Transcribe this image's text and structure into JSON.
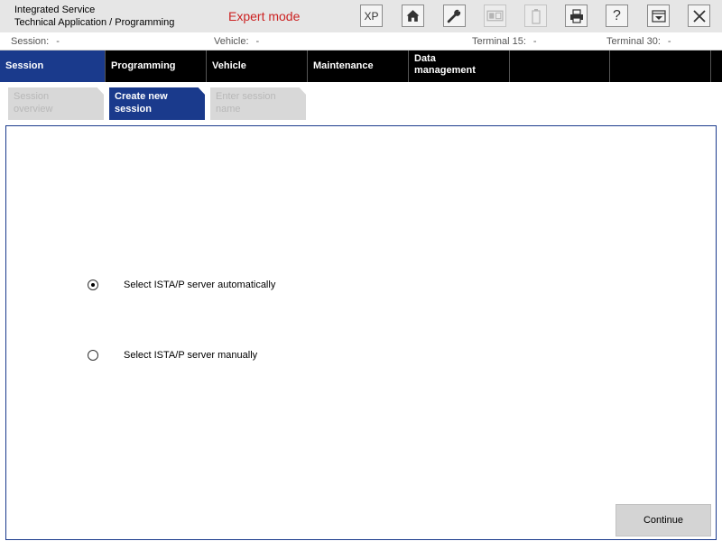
{
  "header": {
    "title_line1": "Integrated Service",
    "title_line2": "Technical Application / Programming",
    "mode": "Expert mode",
    "toolbar": [
      {
        "name": "xp-button",
        "icon": "xp-text",
        "label": "XP",
        "enabled": true
      },
      {
        "name": "home-button",
        "icon": "home-icon",
        "enabled": true
      },
      {
        "name": "service-button",
        "icon": "wrench-icon",
        "enabled": true
      },
      {
        "name": "vehicle-id-button",
        "icon": "id-card-icon",
        "enabled": false
      },
      {
        "name": "battery-button",
        "icon": "battery-icon",
        "enabled": false
      },
      {
        "name": "print-button",
        "icon": "printer-icon",
        "enabled": true
      },
      {
        "name": "help-button",
        "icon": "help-icon",
        "label": "?",
        "enabled": true
      },
      {
        "name": "minimize-button",
        "icon": "minimize-icon",
        "enabled": true
      },
      {
        "name": "close-button",
        "icon": "close-icon",
        "enabled": true
      }
    ]
  },
  "status": {
    "session_label": "Session:",
    "session_value": "-",
    "vehicle_label": "Vehicle:",
    "vehicle_value": "-",
    "terminal15_label": "Terminal 15:",
    "terminal15_value": "-",
    "terminal30_label": "Terminal 30:",
    "terminal30_value": "-"
  },
  "nav": {
    "tabs": [
      {
        "label": "Session",
        "active": true
      },
      {
        "label": "Programming",
        "active": false
      },
      {
        "label": "Vehicle",
        "active": false
      },
      {
        "label": "Maintenance",
        "active": false
      },
      {
        "label_line1": "Data",
        "label_line2": "management",
        "active": false
      }
    ]
  },
  "subtabs": [
    {
      "line1": "Session",
      "line2": "overview",
      "active": false
    },
    {
      "line1": "Create new",
      "line2": "session",
      "active": true
    },
    {
      "line1": "Enter session",
      "line2": "name",
      "active": false
    }
  ],
  "main": {
    "options": [
      {
        "label": "Select ISTA/P server automatically",
        "selected": true
      },
      {
        "label": "Select ISTA/P server manually",
        "selected": false
      }
    ],
    "continue_label": "Continue"
  },
  "colors": {
    "accent": "#1a3a8c",
    "mode_text": "#cc2222",
    "nav_bg": "#000000",
    "header_bg": "#e6e6e6"
  }
}
